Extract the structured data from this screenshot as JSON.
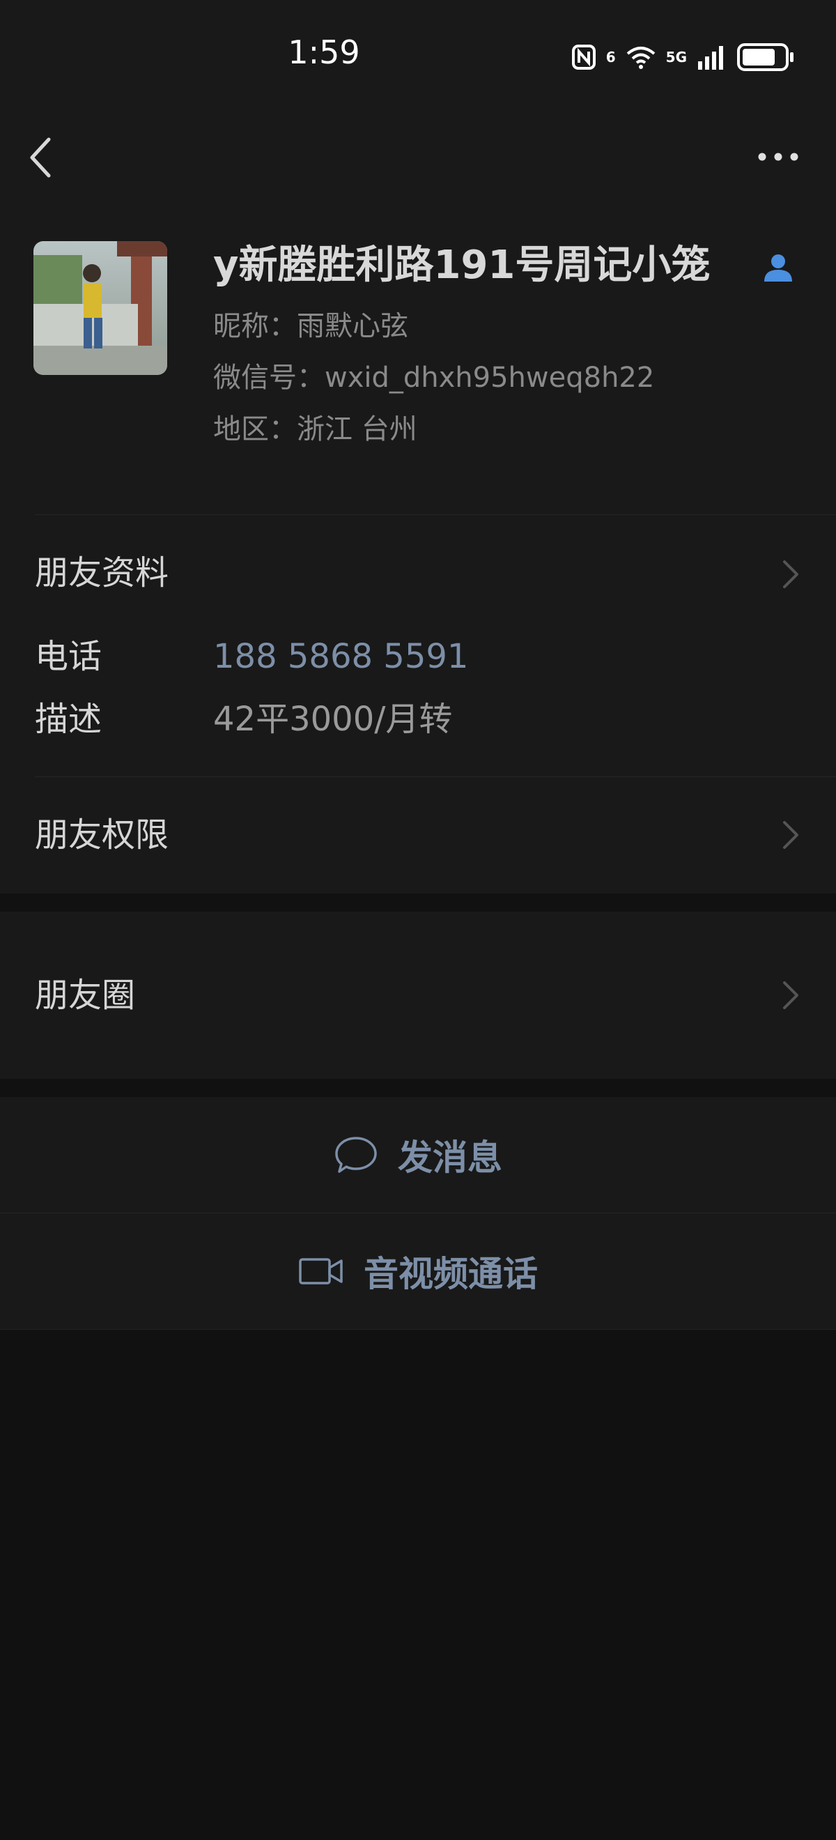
{
  "status_bar": {
    "time": "1:59",
    "network_label": "5G",
    "wifi_label": "6",
    "icons": [
      "nfc-icon",
      "wifi-icon",
      "signal-icon",
      "battery-icon"
    ],
    "battery_level": 0.8
  },
  "nav": {
    "back_icon": "chevron-left-icon",
    "more_icon": "more-dots-icon"
  },
  "profile": {
    "name": "y新塍胜利路191号周记小笼",
    "nickname": "昵称：雨默心弦",
    "wechat_id": "微信号：wxid_dhxh95hweq8h22",
    "region": "地区：浙江  台州",
    "verified_icon": "person-icon"
  },
  "rows": {
    "friend_profile": "朋友资料",
    "phone_label": "电话",
    "phone_value": "188 5868 5591",
    "desc_label": "描述",
    "desc_value": "42平3000/月转",
    "permissions": "朋友权限",
    "moments": "朋友圈"
  },
  "actions": {
    "message": "发消息",
    "message_icon": "chat-bubble-icon",
    "call": "音视频通话",
    "call_icon": "video-camera-icon"
  },
  "colors": {
    "background": "#111111",
    "panel": "#191919",
    "link": "#7d8fa8",
    "accent": "#4a8fe0"
  }
}
